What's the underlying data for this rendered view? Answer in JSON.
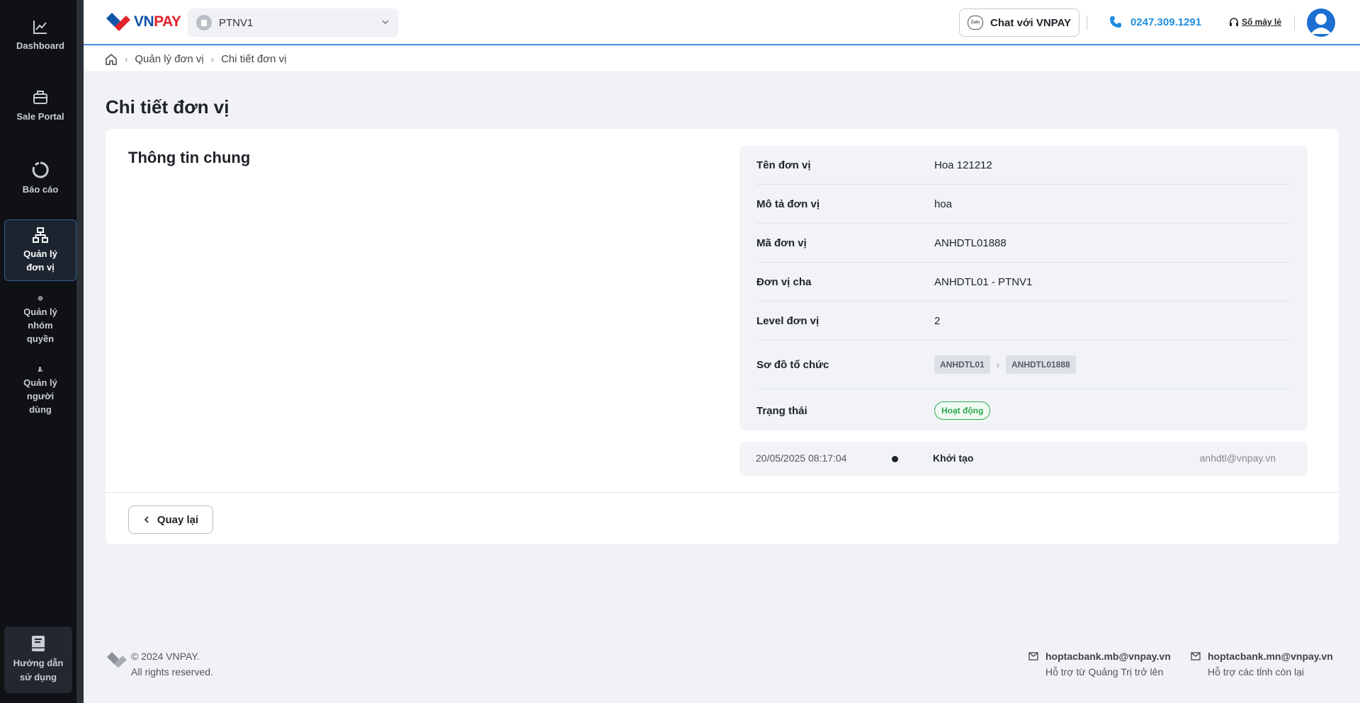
{
  "sidebar": {
    "items": [
      {
        "label": "Dashboard",
        "icon": "chart-line-icon"
      },
      {
        "label": "Sale Portal",
        "icon": "briefcase-icon"
      },
      {
        "label": "Báo cáo",
        "icon": "report-icon"
      },
      {
        "label": "Quản lý đơn vị",
        "icon": "org-chart-icon",
        "active": true
      },
      {
        "label": "Quản lý nhóm quyền",
        "icon": "group-icon"
      },
      {
        "label": "Quản lý người dùng",
        "icon": "user-settings-icon"
      }
    ],
    "guide_label": "Hướng dẫn sử dụng"
  },
  "header": {
    "logo_main": "VN",
    "logo_accent": "PAY",
    "org_selected": "PTNV1",
    "chat_label": "Chat với VNPAY",
    "chat_badge": "Zalo",
    "phone": "0247.309.1291",
    "hotline_label": "Số máy lẻ"
  },
  "breadcrumb": {
    "items": [
      "Quản lý đơn vị",
      "Chi tiết đơn vị"
    ]
  },
  "page": {
    "title": "Chi tiết đơn vị",
    "section_title": "Thông tin chung"
  },
  "details": {
    "ten_don_vi": {
      "label": "Tên đơn vị",
      "value": "Hoa 121212"
    },
    "mo_ta": {
      "label": "Mô tả đơn vị",
      "value": "hoa"
    },
    "ma_don_vi": {
      "label": "Mã đơn vị",
      "value": "ANHDTL01888"
    },
    "don_vi_cha": {
      "label": "Đơn vị cha",
      "value": "ANHDTL01 - PTNV1"
    },
    "level": {
      "label": "Level đơn vị",
      "value": "2"
    },
    "so_do": {
      "label": "Sơ đồ tổ chức",
      "nodes": [
        "ANHDTL01",
        "ANHDTL01888"
      ]
    },
    "trang_thai": {
      "label": "Trạng thái",
      "value": "Hoạt động"
    }
  },
  "log": {
    "time": "20/05/2025 08:17:04",
    "action": "Khởi tạo",
    "user": "anhdtl@vnpay.vn"
  },
  "actions": {
    "back_label": "Quay lại"
  },
  "footer": {
    "copyright_line1": "© 2024 VNPAY.",
    "copyright_line2": "All rights reserved.",
    "contacts": [
      {
        "email": "hoptacbank.mb@vnpay.vn",
        "desc": "Hỗ trợ từ Quảng Trị trở lên"
      },
      {
        "email": "hoptacbank.mn@vnpay.vn",
        "desc": "Hỗ trợ các tỉnh còn lại"
      }
    ]
  },
  "colors": {
    "accent": "#1f8de0",
    "sidebar_bg": "#0f1114",
    "status_active": "#2fa84f"
  }
}
